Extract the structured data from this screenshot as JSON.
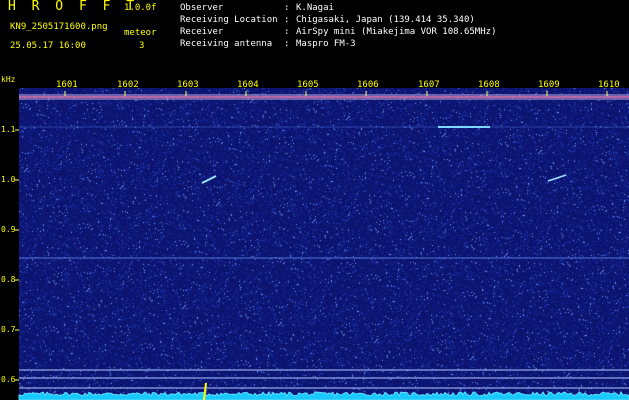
{
  "header": {
    "logo": "H R O F F T",
    "version": "1.0.0f",
    "filename": "KN9_2505171600.png",
    "mode": "meteor",
    "datetime": "25.05.17 16:00",
    "count": "3",
    "info": [
      {
        "label": "Observer",
        "value": "K.Nagai"
      },
      {
        "label": "Receiving Location",
        "value": "Chigasaki, Japan (139.414 35.340)"
      },
      {
        "label": "Receiver",
        "value": "AirSpy mini (Miakejima VOR 108.65MHz)"
      },
      {
        "label": "Receiving antenna",
        "value": "Maspro FM-3"
      }
    ]
  },
  "axis": {
    "unit": "kHz",
    "y_ticks": [
      "1.1",
      "1.0",
      "0.9",
      "0.8",
      "0.7",
      "0.6"
    ],
    "x_ticks": [
      "1601",
      "1602",
      "1603",
      "1604",
      "1605",
      "1606",
      "1607",
      "1608",
      "1609",
      "1610"
    ]
  },
  "colors": {
    "background": "#0c1470",
    "text": "#ffff00",
    "signal": "#7fd8ff"
  }
}
